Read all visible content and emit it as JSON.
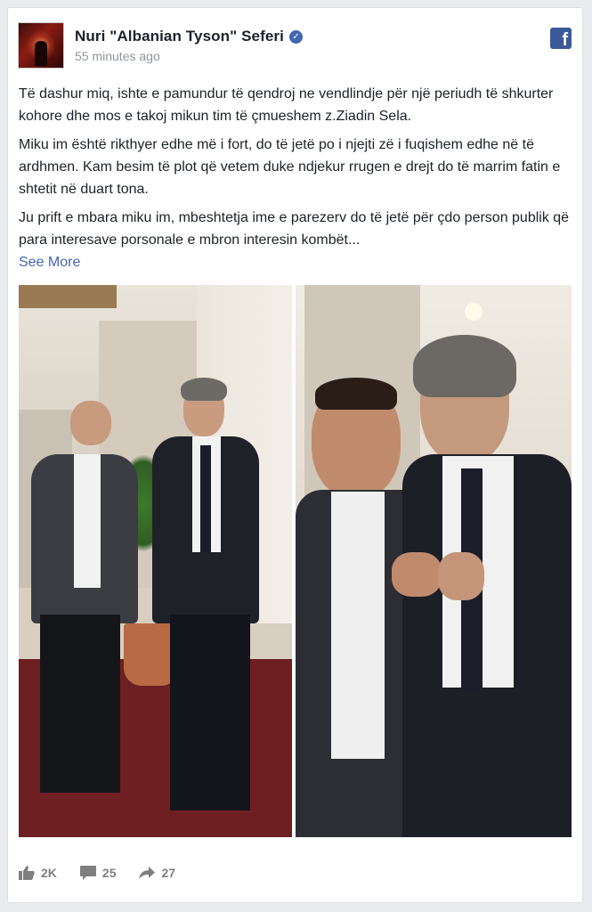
{
  "post": {
    "author": "Nuri \"Albanian Tyson\" Seferi",
    "timestamp": "55 minutes ago",
    "paragraphs": [
      "Të dashur miq, ishte e pamundur të qendroj ne vendlindje për një periudh të shkurter kohore dhe mos e takoj mikun tim të çmueshem z.Ziadin Sela.",
      "Miku im është rikthyer edhe më i fort, do të jetë po i njejti zë i fuqishem edhe në të ardhmen. Kam besim të plot që vetem duke ndjekur rrugen e drejt do të marrim fatin e shtetit në duart tona.",
      "Ju prift e mbara miku im, mbeshtetja ime e parezerv do të jetë për çdo person publik që para interesave porsonale e mbron interesin kombët..."
    ],
    "see_more": "See More"
  },
  "icons": {
    "verified": "verified-check-icon",
    "facebook": "facebook-logo-icon",
    "like": "thumbs-up-icon",
    "comment": "comment-icon",
    "share": "share-arrow-icon"
  },
  "stats": {
    "likes": "2K",
    "comments": "25",
    "shares": "27"
  },
  "colors": {
    "link": "#4267b2",
    "facebook_blue": "#3b5998",
    "muted": "#90949c",
    "background": "#e9ebee"
  }
}
